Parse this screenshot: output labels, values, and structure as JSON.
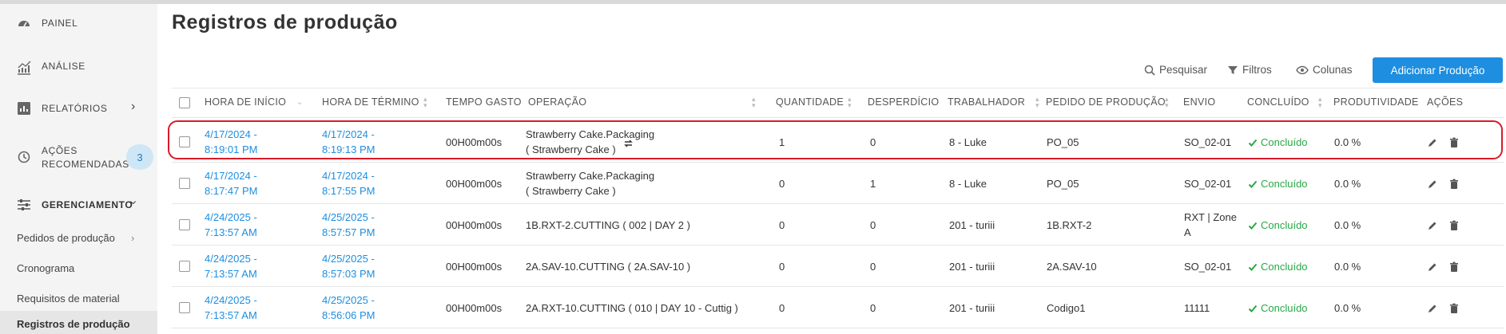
{
  "sidebar": {
    "painel": "PAINEL",
    "analise": "ANÁLISE",
    "relatorios": "RELATÓRIOS",
    "acoes_line1": "AÇÕES",
    "acoes_line2": "RECOMENDADAS",
    "acoes_badge": "3",
    "gerenciamento": "GERENCIAMENTO",
    "sub_items": [
      "Pedidos de produção",
      "Cronograma",
      "Requisitos de material",
      "Registros de produção"
    ]
  },
  "page_title": "Registros de produção",
  "toolbar": {
    "search": "Pesquisar",
    "filters": "Filtros",
    "columns": "Colunas",
    "add": "Adicionar Produção"
  },
  "table": {
    "headers": [
      "HORA DE INÍCIO",
      "HORA DE TÉRMINO",
      "TEMPO GASTO",
      "OPERAÇÃO",
      "QUANTIDADE",
      "DESPERDÍCIO",
      "TRABALHADOR",
      "PEDIDO DE PRODUÇÃO",
      "ENVIO",
      "CONCLUÍDO",
      "PRODUTIVIDADE",
      "AÇÕES"
    ],
    "rows": [
      {
        "start1": "4/17/2024 -",
        "start2": "8:19:01 PM",
        "end1": "4/17/2024 -",
        "end2": "8:19:13 PM",
        "time": "00H00m00s",
        "op1": "Strawberry Cake.Packaging",
        "op2": "( Strawberry Cake )",
        "qty": "1",
        "waste": "0",
        "worker": "8 - Luke",
        "order": "PO_05",
        "ship1": "SO_02-01",
        "ship2": "",
        "done": "Concluído",
        "prod": "0.0 %"
      },
      {
        "start1": "4/17/2024 -",
        "start2": "8:17:47 PM",
        "end1": "4/17/2024 -",
        "end2": "8:17:55 PM",
        "time": "00H00m00s",
        "op1": "Strawberry Cake.Packaging",
        "op2": "( Strawberry Cake )",
        "qty": "0",
        "waste": "1",
        "worker": "8 - Luke",
        "order": "PO_05",
        "ship1": "SO_02-01",
        "ship2": "",
        "done": "Concluído",
        "prod": "0.0 %"
      },
      {
        "start1": "4/24/2025 -",
        "start2": "7:13:57 AM",
        "end1": "4/25/2025 -",
        "end2": "8:57:57 PM",
        "time": "00H00m00s",
        "op1": "1B.RXT-2.CUTTING ( 002 | DAY 2 )",
        "op2": "",
        "qty": "0",
        "waste": "0",
        "worker": "201 - turiii",
        "order": "1B.RXT-2",
        "ship1": "RXT | Zone",
        "ship2": "A",
        "done": "Concluído",
        "prod": "0.0 %"
      },
      {
        "start1": "4/24/2025 -",
        "start2": "7:13:57 AM",
        "end1": "4/25/2025 -",
        "end2": "8:57:03 PM",
        "time": "00H00m00s",
        "op1": "2A.SAV-10.CUTTING ( 2A.SAV-10 )",
        "op2": "",
        "qty": "0",
        "waste": "0",
        "worker": "201 - turiii",
        "order": "2A.SAV-10",
        "ship1": "SO_02-01",
        "ship2": "",
        "done": "Concluído",
        "prod": "0.0 %"
      },
      {
        "start1": "4/24/2025 -",
        "start2": "7:13:57 AM",
        "end1": "4/25/2025 -",
        "end2": "8:56:06 PM",
        "time": "00H00m00s",
        "op1": "2A.RXT-10.CUTTING ( 010 | DAY 10 - Cuttig )",
        "op2": "",
        "qty": "0",
        "waste": "0",
        "worker": "201 - turiii",
        "order": "Codigo1",
        "ship1": "11111",
        "ship2": "",
        "done": "Concluído",
        "prod": "0.0 %"
      }
    ]
  },
  "colors": {
    "accent": "#1d8ee0",
    "success": "#27a844",
    "highlight": "#d81b2a"
  }
}
